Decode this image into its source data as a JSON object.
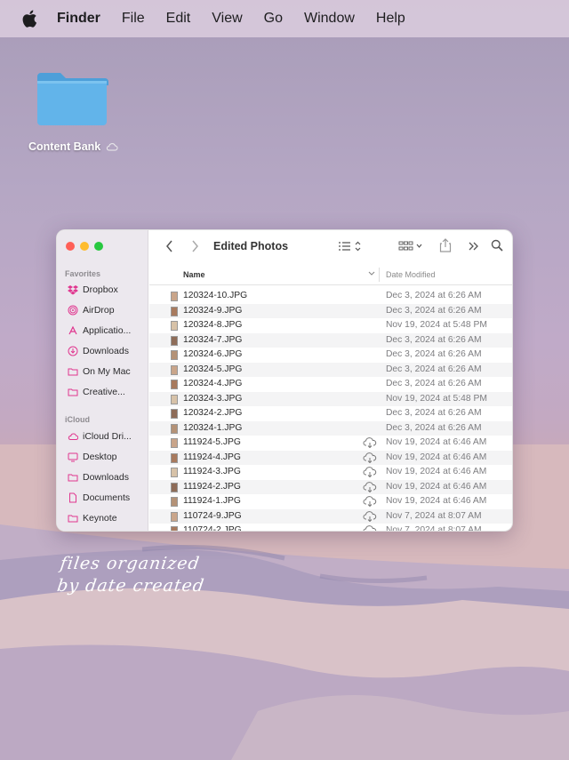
{
  "menubar": {
    "items": [
      "Finder",
      "File",
      "Edit",
      "View",
      "Go",
      "Window",
      "Help"
    ]
  },
  "desktop": {
    "folder_label": "Content Bank"
  },
  "finder": {
    "title": "Edited Photos",
    "sidebar": {
      "favorites_header": "Favorites",
      "favorites": [
        {
          "label": "Dropbox",
          "icon": "dropbox-icon"
        },
        {
          "label": "AirDrop",
          "icon": "airdrop-icon"
        },
        {
          "label": "Applicatio...",
          "icon": "applications-icon"
        },
        {
          "label": "Downloads",
          "icon": "downloads-icon"
        },
        {
          "label": "On My Mac",
          "icon": "folder-icon"
        },
        {
          "label": "Creative...",
          "icon": "folder-icon"
        }
      ],
      "icloud_header": "iCloud",
      "icloud": [
        {
          "label": "iCloud Dri...",
          "icon": "icloud-icon"
        },
        {
          "label": "Desktop",
          "icon": "desktop-icon"
        },
        {
          "label": "Downloads",
          "icon": "folder-icon"
        },
        {
          "label": "Documents",
          "icon": "document-icon"
        },
        {
          "label": "Keynote",
          "icon": "folder-icon"
        }
      ]
    },
    "columns": {
      "name": "Name",
      "date": "Date Modified"
    },
    "files": [
      {
        "name": "120324-10.JPG",
        "date": "Dec 3, 2024 at 6:26 AM",
        "cloud": false
      },
      {
        "name": "120324-9.JPG",
        "date": "Dec 3, 2024 at 6:26 AM",
        "cloud": false
      },
      {
        "name": "120324-8.JPG",
        "date": "Nov 19, 2024 at 5:48 PM",
        "cloud": false
      },
      {
        "name": "120324-7.JPG",
        "date": "Dec 3, 2024 at 6:26 AM",
        "cloud": false
      },
      {
        "name": "120324-6.JPG",
        "date": "Dec 3, 2024 at 6:26 AM",
        "cloud": false
      },
      {
        "name": "120324-5.JPG",
        "date": "Dec 3, 2024 at 6:26 AM",
        "cloud": false
      },
      {
        "name": "120324-4.JPG",
        "date": "Dec 3, 2024 at 6:26 AM",
        "cloud": false
      },
      {
        "name": "120324-3.JPG",
        "date": "Nov 19, 2024 at 5:48 PM",
        "cloud": false
      },
      {
        "name": "120324-2.JPG",
        "date": "Dec 3, 2024 at 6:26 AM",
        "cloud": false
      },
      {
        "name": "120324-1.JPG",
        "date": "Dec 3, 2024 at 6:26 AM",
        "cloud": false
      },
      {
        "name": "111924-5.JPG",
        "date": "Nov 19, 2024 at 6:46 AM",
        "cloud": true
      },
      {
        "name": "111924-4.JPG",
        "date": "Nov 19, 2024 at 6:46 AM",
        "cloud": true
      },
      {
        "name": "111924-3.JPG",
        "date": "Nov 19, 2024 at 6:46 AM",
        "cloud": true
      },
      {
        "name": "111924-2.JPG",
        "date": "Nov 19, 2024 at 6:46 AM",
        "cloud": true
      },
      {
        "name": "111924-1.JPG",
        "date": "Nov 19, 2024 at 6:46 AM",
        "cloud": true
      },
      {
        "name": "110724-9.JPG",
        "date": "Nov 7, 2024 at 8:07 AM",
        "cloud": true
      },
      {
        "name": "110724-2.JPG",
        "date": "Nov 7, 2024 at 8:07 AM",
        "cloud": true
      }
    ]
  },
  "caption": {
    "line1": "files organized",
    "line2": "by date created"
  },
  "colors": {
    "sidebar_icon": "#e0368f",
    "traffic_close": "#ff5f57",
    "traffic_min": "#febc2e",
    "traffic_max": "#28c840",
    "folder": "#5fb3e8"
  }
}
